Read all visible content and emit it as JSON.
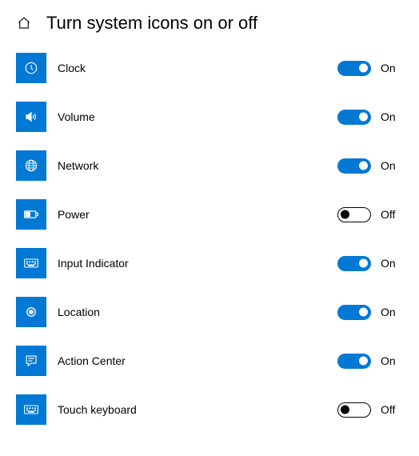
{
  "header": {
    "title": "Turn system icons on or off"
  },
  "labels": {
    "on": "On",
    "off": "Off"
  },
  "items": [
    {
      "icon": "clock-icon",
      "label": "Clock",
      "state": true
    },
    {
      "icon": "volume-icon",
      "label": "Volume",
      "state": true
    },
    {
      "icon": "network-icon",
      "label": "Network",
      "state": true
    },
    {
      "icon": "power-icon",
      "label": "Power",
      "state": false
    },
    {
      "icon": "keyboard-icon",
      "label": "Input Indicator",
      "state": true
    },
    {
      "icon": "location-icon",
      "label": "Location",
      "state": true
    },
    {
      "icon": "action-center-icon",
      "label": "Action Center",
      "state": true
    },
    {
      "icon": "keyboard-icon",
      "label": "Touch keyboard",
      "state": false
    }
  ]
}
